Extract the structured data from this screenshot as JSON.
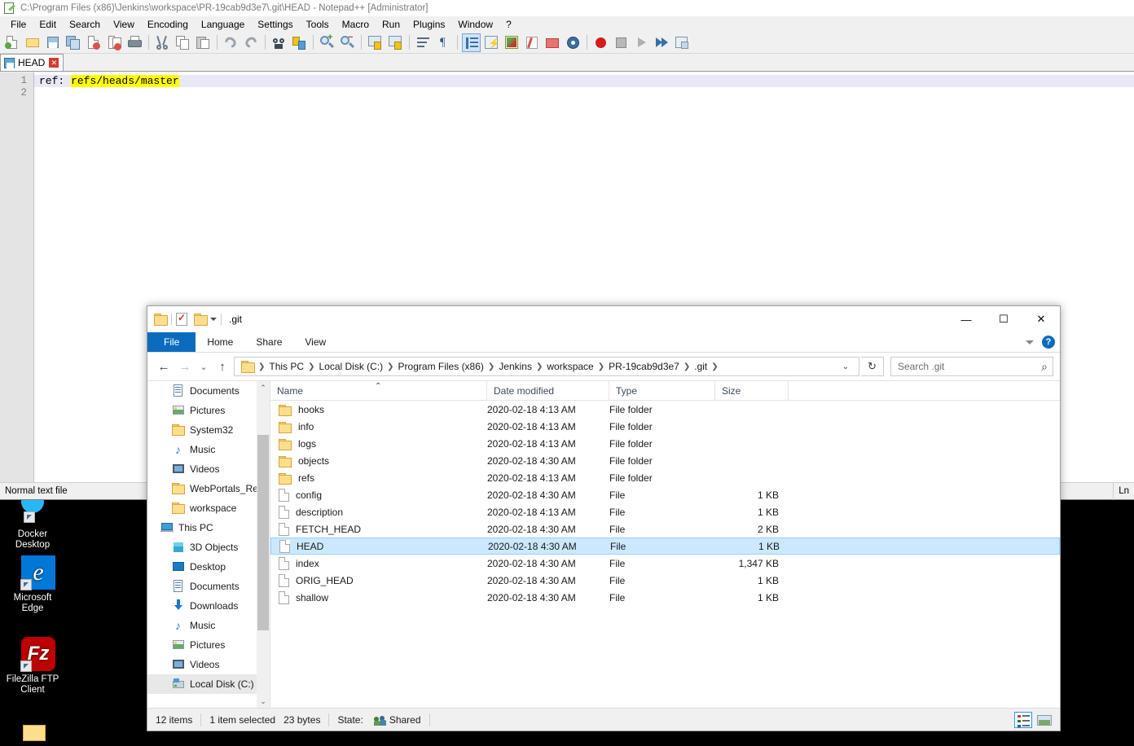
{
  "notepadpp": {
    "title": "C:\\Program Files (x86)\\Jenkins\\workspace\\PR-19cab9d3e7\\.git\\HEAD - Notepad++ [Administrator]",
    "menu": [
      "File",
      "Edit",
      "Search",
      "View",
      "Encoding",
      "Language",
      "Settings",
      "Tools",
      "Macro",
      "Run",
      "Plugins",
      "Window",
      "?"
    ],
    "tab": {
      "label": "HEAD",
      "close_label": "✕"
    },
    "line_numbers": [
      "1",
      "2"
    ],
    "code": {
      "line1_prefix": "ref: ",
      "line1_highlight": "refs/heads/master",
      "line2": ""
    },
    "status": {
      "file_type": "Normal text file",
      "right_label": "Ln"
    },
    "toolbar_icons": [
      "new-file-icon",
      "open-file-icon",
      "save-icon",
      "save-all-icon",
      "close-file-icon",
      "close-all-icon",
      "print-icon",
      "cut-icon",
      "copy-icon",
      "paste-icon",
      "undo-icon",
      "redo-icon",
      "find-icon",
      "replace-icon",
      "zoom-in-icon",
      "zoom-out-icon",
      "sync-vertical-icon",
      "sync-horizontal-icon",
      "word-wrap-icon",
      "show-all-chars-icon",
      "indent-guide-icon",
      "ui-userdefined-icon",
      "function-list-icon",
      "document-map-icon",
      "folder-as-workspace-icon",
      "monitoring-icon",
      "record-macro-icon",
      "stop-macro-icon",
      "play-macro-icon",
      "run-macro-multiple-icon",
      "save-macro-icon"
    ]
  },
  "explorer": {
    "window_title": ".git",
    "quick_access": [
      "folder-icon",
      "properties-icon",
      "new-folder-icon",
      "customize-dropdown-icon"
    ],
    "window_controls": {
      "minimize": "—",
      "maximize": "☐",
      "close": "✕"
    },
    "ribbon_tabs": [
      "File",
      "Home",
      "Share",
      "View"
    ],
    "ribbon_right": {
      "collapse": "chevron-down-icon",
      "help": "?"
    },
    "nav": {
      "back": "←",
      "forward": "→",
      "recent": "⌄",
      "up": "↑",
      "refresh": "↻"
    },
    "breadcrumb": [
      "This PC",
      "Local Disk (C:)",
      "Program Files (x86)",
      "Jenkins",
      "workspace",
      "PR-19cab9d3e7",
      ".git"
    ],
    "search": {
      "placeholder": "Search .git",
      "value": ""
    },
    "navpane": [
      {
        "label": "Documents",
        "icon": "documents-icon",
        "pinned": true,
        "indent": true
      },
      {
        "label": "Pictures",
        "icon": "pictures-icon",
        "pinned": true,
        "indent": true
      },
      {
        "label": "System32",
        "icon": "folder-icon",
        "pinned": true,
        "indent": true
      },
      {
        "label": "Music",
        "icon": "music-icon",
        "pinned": false,
        "indent": true
      },
      {
        "label": "Videos",
        "icon": "videos-icon",
        "pinned": false,
        "indent": true
      },
      {
        "label": "WebPortals_Refe",
        "icon": "folder-icon",
        "pinned": false,
        "indent": true
      },
      {
        "label": "workspace",
        "icon": "folder-icon",
        "pinned": false,
        "indent": true
      },
      {
        "label": "This PC",
        "icon": "this-pc-icon",
        "pinned": false,
        "indent": false
      },
      {
        "label": "3D Objects",
        "icon": "3d-objects-icon",
        "pinned": false,
        "indent": true
      },
      {
        "label": "Desktop",
        "icon": "desktop-icon",
        "pinned": false,
        "indent": true
      },
      {
        "label": "Documents",
        "icon": "documents-icon",
        "pinned": false,
        "indent": true
      },
      {
        "label": "Downloads",
        "icon": "downloads-icon",
        "pinned": false,
        "indent": true
      },
      {
        "label": "Music",
        "icon": "music-icon",
        "pinned": false,
        "indent": true
      },
      {
        "label": "Pictures",
        "icon": "pictures-icon",
        "pinned": false,
        "indent": true
      },
      {
        "label": "Videos",
        "icon": "videos-icon",
        "pinned": false,
        "indent": true
      },
      {
        "label": "Local Disk (C:)",
        "icon": "drive-icon",
        "pinned": false,
        "indent": true,
        "selected": true
      }
    ],
    "columns": [
      "Name",
      "Date modified",
      "Type",
      "Size"
    ],
    "sort_indicator": "ascending",
    "files": [
      {
        "name": "hooks",
        "date": "2020-02-18 4:13 AM",
        "type": "File folder",
        "size": "",
        "kind": "folder"
      },
      {
        "name": "info",
        "date": "2020-02-18 4:13 AM",
        "type": "File folder",
        "size": "",
        "kind": "folder"
      },
      {
        "name": "logs",
        "date": "2020-02-18 4:13 AM",
        "type": "File folder",
        "size": "",
        "kind": "folder"
      },
      {
        "name": "objects",
        "date": "2020-02-18 4:30 AM",
        "type": "File folder",
        "size": "",
        "kind": "folder"
      },
      {
        "name": "refs",
        "date": "2020-02-18 4:13 AM",
        "type": "File folder",
        "size": "",
        "kind": "folder"
      },
      {
        "name": "config",
        "date": "2020-02-18 4:30 AM",
        "type": "File",
        "size": "1 KB",
        "kind": "file"
      },
      {
        "name": "description",
        "date": "2020-02-18 4:13 AM",
        "type": "File",
        "size": "1 KB",
        "kind": "file"
      },
      {
        "name": "FETCH_HEAD",
        "date": "2020-02-18 4:30 AM",
        "type": "File",
        "size": "2 KB",
        "kind": "file"
      },
      {
        "name": "HEAD",
        "date": "2020-02-18 4:30 AM",
        "type": "File",
        "size": "1 KB",
        "kind": "file",
        "selected": true
      },
      {
        "name": "index",
        "date": "2020-02-18 4:30 AM",
        "type": "File",
        "size": "1,347 KB",
        "kind": "file"
      },
      {
        "name": "ORIG_HEAD",
        "date": "2020-02-18 4:30 AM",
        "type": "File",
        "size": "1 KB",
        "kind": "file"
      },
      {
        "name": "shallow",
        "date": "2020-02-18 4:30 AM",
        "type": "File",
        "size": "1 KB",
        "kind": "file"
      }
    ],
    "status": {
      "item_count": "12 items",
      "selection": "1 item selected",
      "selection_size": "23 bytes",
      "state_label": "State:",
      "state_value": "Shared"
    },
    "view_buttons": [
      "details-view-icon",
      "large-icons-view-icon"
    ]
  },
  "desktop": {
    "icons": [
      {
        "label1": "Docker",
        "label2": "Desktop",
        "icon": "docker-desktop-icon"
      },
      {
        "label1": "Microsoft",
        "label2": "Edge",
        "icon": "microsoft-edge-icon"
      },
      {
        "label1": "FileZilla FTP",
        "label2": "Client",
        "icon": "filezilla-ftp-client-icon"
      }
    ]
  },
  "colors": {
    "accent_blue": "#0b6cbf",
    "selection_blue": "#cce8ff",
    "highlight_yellow": "#ffff00",
    "edge_blue": "#0078d7",
    "filezilla_red": "#bf0000"
  }
}
